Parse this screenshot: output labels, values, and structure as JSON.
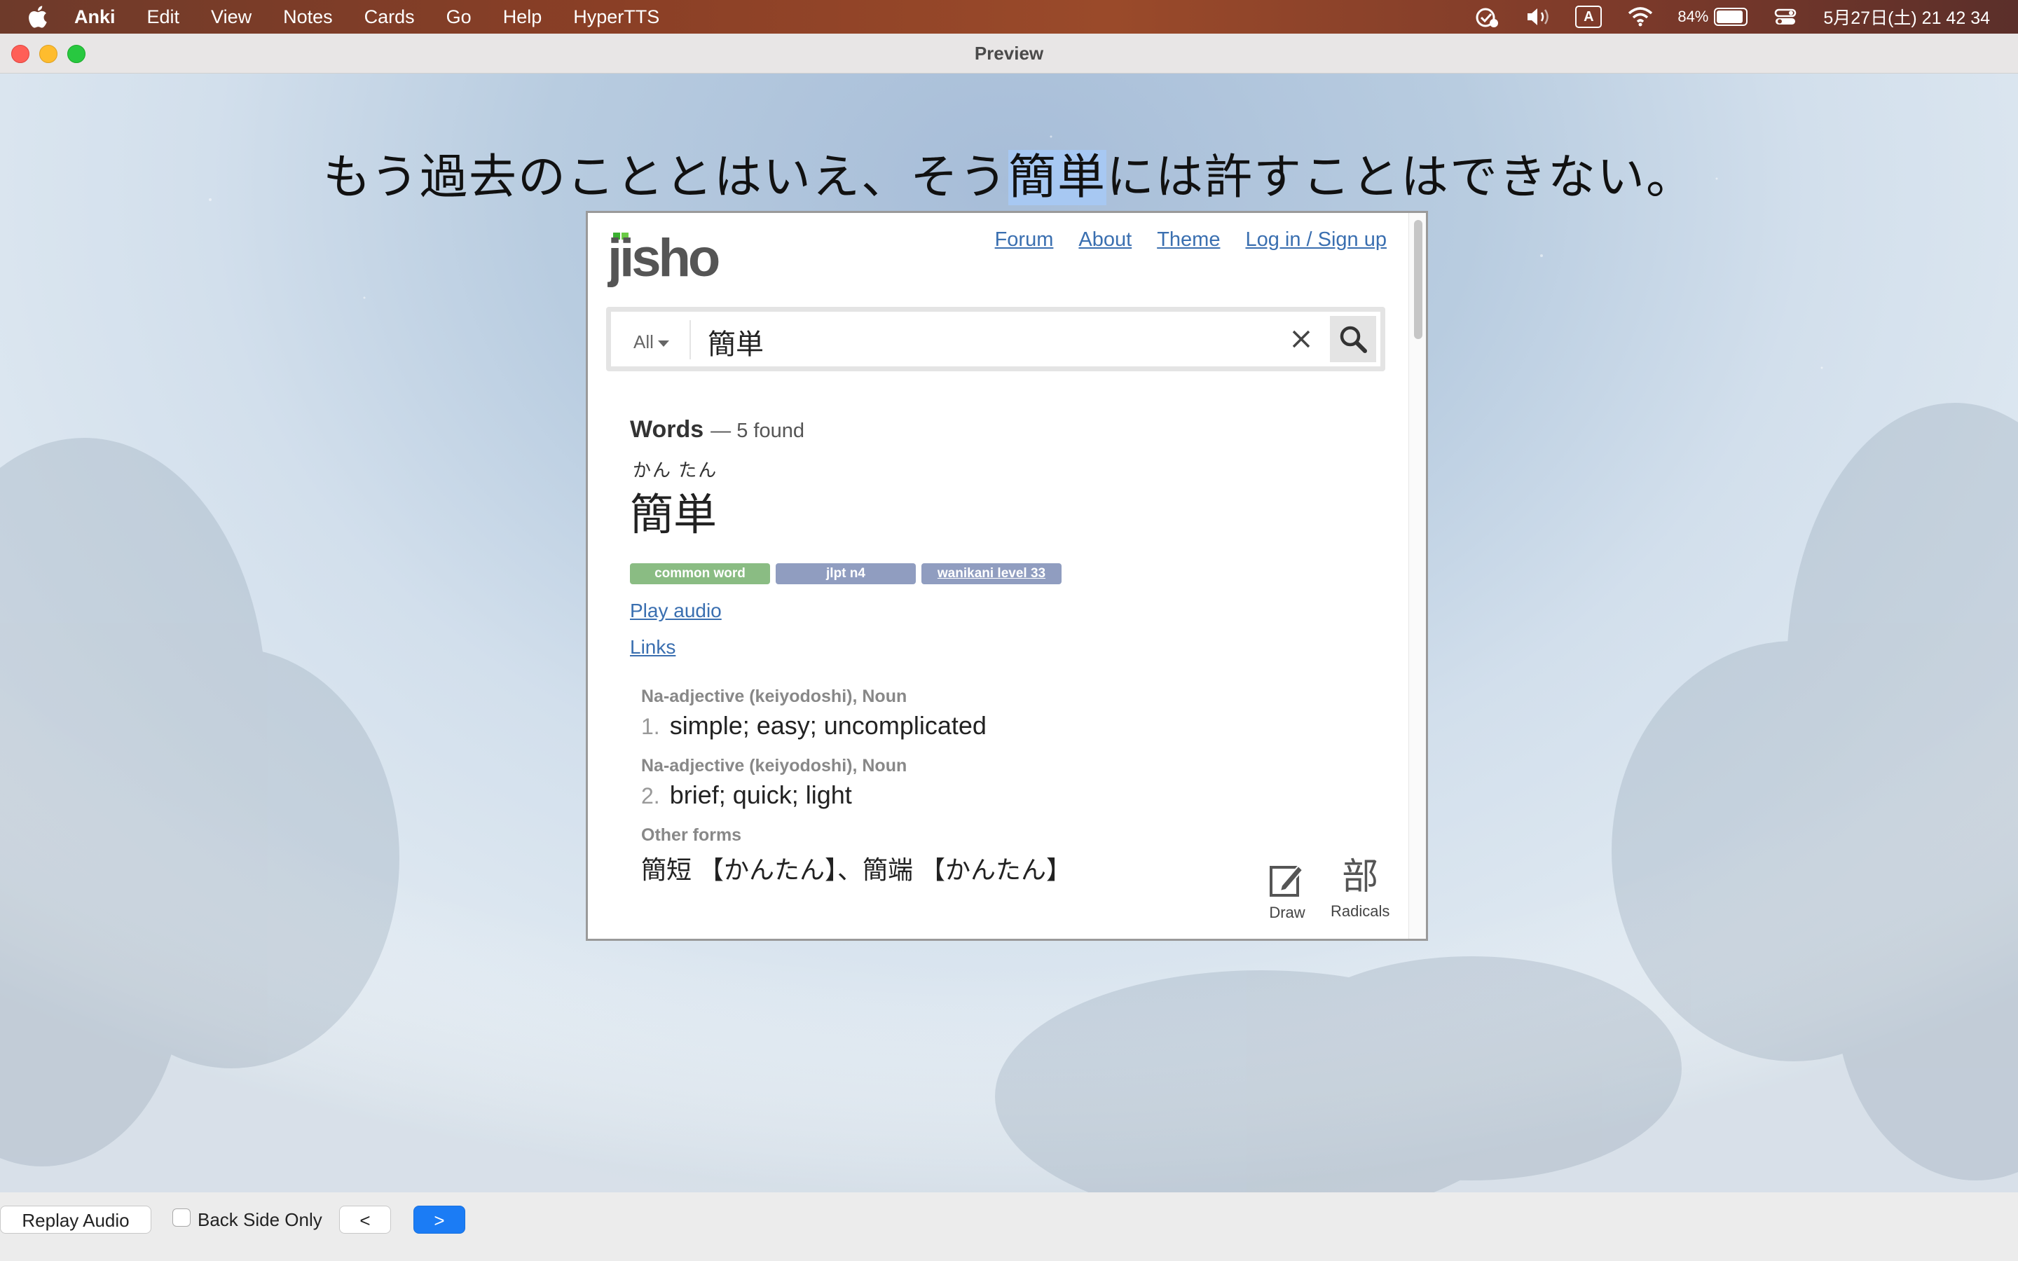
{
  "menubar": {
    "app": "Anki",
    "menus": [
      "Edit",
      "View",
      "Notes",
      "Cards",
      "Go",
      "Help",
      "HyperTTS"
    ],
    "input_source": "A",
    "battery": "84%",
    "battery_level": 0.84,
    "datetime": "5月27日(土)  21 42 34"
  },
  "window": {
    "title": "Preview"
  },
  "card": {
    "sentence_before": "もう過去のこととはいえ、そう",
    "sentence_highlight": "簡単",
    "sentence_after": "には許すことはできない。"
  },
  "jisho": {
    "logo": "jisho",
    "nav": [
      "Forum",
      "About",
      "Theme",
      "Log in / Sign up"
    ],
    "search": {
      "category": "All",
      "query": "簡単"
    },
    "results": {
      "heading": "Words",
      "count": "— 5 found",
      "furigana": "かん たん",
      "word": "簡単",
      "tags": [
        "common word",
        "jlpt n4",
        "wanikani level 33"
      ],
      "play_audio": "Play audio",
      "links": "Links",
      "senses": [
        {
          "tags": "Na-adjective (keiyodoshi), Noun",
          "num": "1.",
          "meaning": "simple; easy; uncomplicated"
        },
        {
          "tags": "Na-adjective (keiyodoshi), Noun",
          "num": "2.",
          "meaning": "brief; quick; light"
        }
      ],
      "other_forms_label": "Other forms",
      "other_forms": "簡短 【かんたん】、簡端 【かんたん】"
    },
    "tools": {
      "draw": "Draw",
      "radicals": "Radicals",
      "radicals_glyph": "部"
    }
  },
  "bottombar": {
    "replay": "Replay Audio",
    "back_side_only": "Back Side Only",
    "back_side_only_checked": false,
    "prev": "<",
    "next": ">"
  }
}
